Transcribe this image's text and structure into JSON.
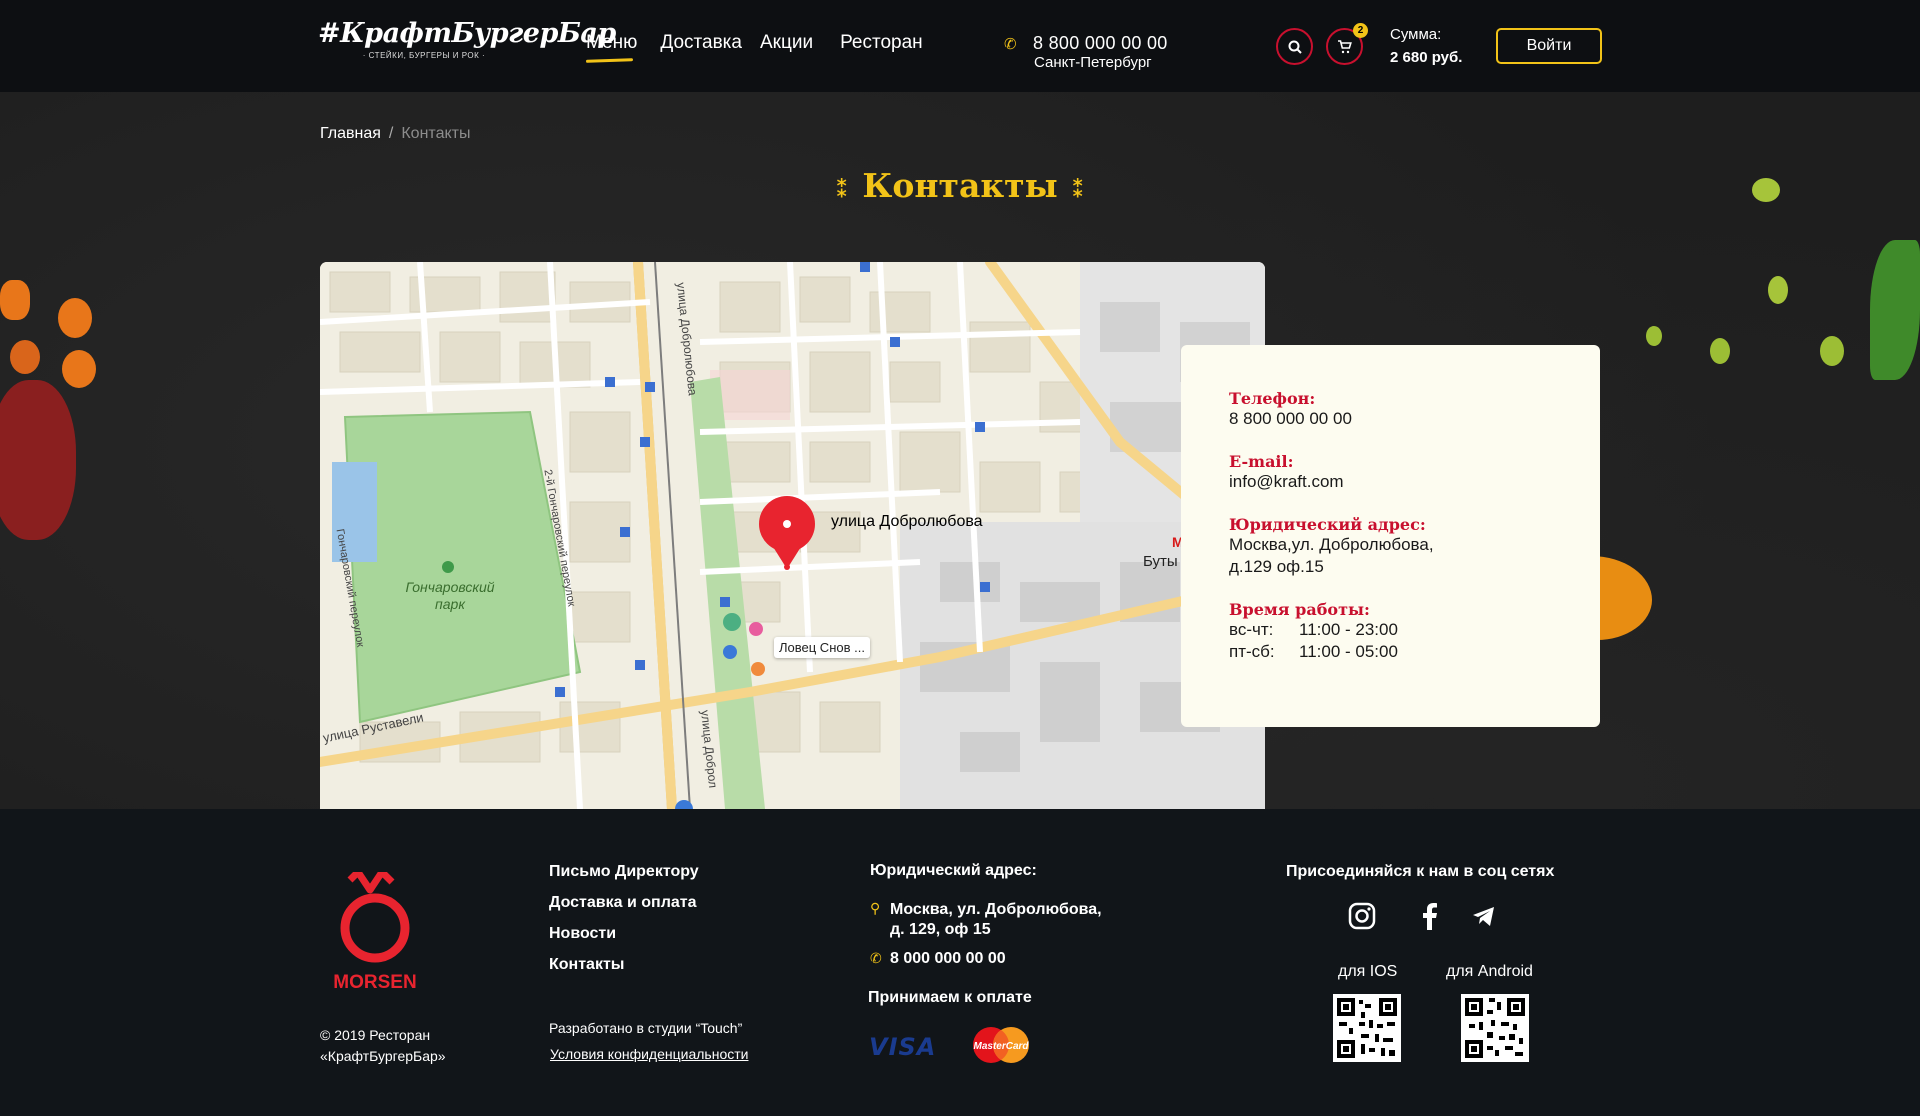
{
  "header": {
    "logo_text": "#КрафтБургерБар",
    "logo_sub": "· СТЕЙКИ, БУРГЕРЫ И РОК ·",
    "nav": [
      {
        "label": "Меню",
        "active": true
      },
      {
        "label": "Доставка",
        "active": false
      },
      {
        "label": "Акции",
        "active": false
      },
      {
        "label": "Ресторан",
        "active": false
      }
    ],
    "phone": "8 800 000 00 00",
    "city": "Санкт-Петербург",
    "search_icon": "search-icon",
    "cart_icon": "cart-icon",
    "cart_count": "2",
    "sum_label": "Сумма:",
    "sum_value": "2 680 руб.",
    "login_label": "Войти"
  },
  "breadcrumb": {
    "home": "Главная",
    "separator": "/",
    "current": "Контакты"
  },
  "page": {
    "title": "Контакты"
  },
  "map": {
    "marker_label": "улица Добролюбова",
    "park_label": "Гончаровский парк",
    "poi_label": "Ловец Снов ...",
    "street_dobrolyubova": "улица Добролюбова",
    "street_dobrol_short": "улица Доброл",
    "street_rustaveli": "улица Руставели",
    "street_goncharovsky_2": "2-й Гончаровский переулок",
    "street_goncharovsky": "Гончаровский переулок",
    "metro_label": "Буты",
    "metro_icon": "metro-icon"
  },
  "contacts": {
    "phone_label": "Телефон:",
    "phone_value": "8 800 000 00 00",
    "email_label": "E-mail:",
    "email_value": "info@kraft.com",
    "address_label": "Юридический адрес:",
    "address_line1": "Москва,ул. Добролюбова,",
    "address_line2": "д.129 оф.15",
    "hours_label": "Время работы:",
    "hours": [
      {
        "days": "вс-чт:",
        "time": "11:00 - 23:00"
      },
      {
        "days": "пт-сб:",
        "time": "11:00 - 05:00"
      }
    ]
  },
  "footer": {
    "brand": "MORSEN",
    "copyright_line1": "© 2019 Ресторан",
    "copyright_line2": "«КрафтБургерБар»",
    "links": [
      "Письмо Директору",
      "Доставка и оплата",
      "Новости",
      "Контакты"
    ],
    "developed_by": "Разработано в студии “Touch”",
    "privacy": "Условия конфиденциальности",
    "legal_title": "Юридический адрес:",
    "address_line1": "Москва, ул. Добролюбова,",
    "address_line2": "д. 129, оф 15",
    "phone": "8 000 000 00 00",
    "payment_title": "Принимаем к оплате",
    "visa": "VISA",
    "mastercard": "MasterCard",
    "social_title": "Присоединяйся к нам в соц сетях",
    "social_icons": [
      "instagram-icon",
      "facebook-icon",
      "telegram-icon"
    ],
    "ios_label": "для IOS",
    "android_label": "для Android"
  },
  "colors": {
    "accent": "#f2c318",
    "brand_red": "#c8102e",
    "header_bg": "#0d0f12",
    "card_bg": "#fdfcf0"
  }
}
